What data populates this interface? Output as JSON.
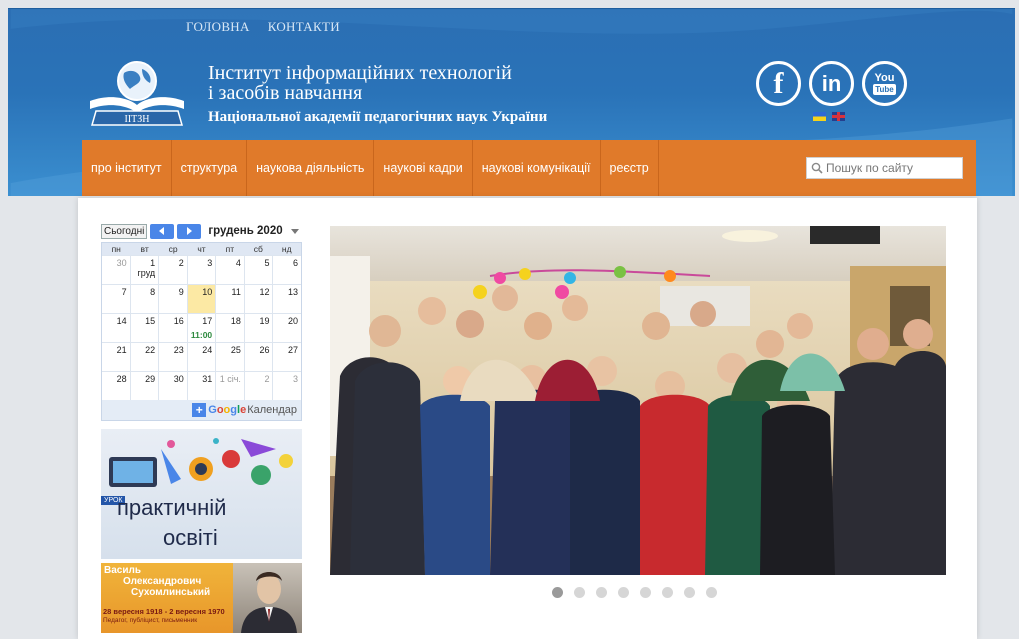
{
  "top_nav": {
    "home": "ГОЛОВНА",
    "contacts": "КОНТАКТИ"
  },
  "logo": {
    "label": "ІІТЗН"
  },
  "titles": {
    "line1": "Інститут інформаційних технологій",
    "line2": "і засобів навчання",
    "line3": "Національної академії педагогічних наук України"
  },
  "social": {
    "facebook": "f",
    "linkedin": "in",
    "youtube_top": "You",
    "youtube_bottom": "Tube"
  },
  "menu": {
    "items": [
      "про інститут",
      "структура",
      "наукова діяльність",
      "наукові кадри",
      "наукові комунікації",
      "реєстр"
    ]
  },
  "search": {
    "placeholder": "Пошук по сайту"
  },
  "calendar": {
    "today": "Сьогодні",
    "month": "грудень 2020",
    "weekdays": [
      "пн",
      "вт",
      "ср",
      "чт",
      "пт",
      "сб",
      "нд"
    ],
    "weeks": [
      [
        "30",
        "1 груд",
        "2",
        "3",
        "4",
        "5",
        "6"
      ],
      [
        "7",
        "8",
        "9",
        "10",
        "11",
        "12",
        "13"
      ],
      [
        "14",
        "15",
        "16",
        "17",
        "18",
        "19",
        "20"
      ],
      [
        "21",
        "22",
        "23",
        "24",
        "25",
        "26",
        "27"
      ],
      [
        "28",
        "29",
        "30",
        "31",
        "1 січ.",
        "2",
        "3"
      ]
    ],
    "event_time": "11:00",
    "google": "Google",
    "calendar_word": "Календар"
  },
  "banner1": {
    "tag": "УРОК",
    "line1": "практичній",
    "line2": "освіті"
  },
  "banner2": {
    "line1": "Василь",
    "line2": "Олександрович",
    "line3": "Сухомлинський",
    "dates": "28 вересня 1918 - 2 вересня 1970",
    "role": "Педагог, публіцист, письменник"
  },
  "slider": {
    "total_dots": 8,
    "active_dot": 1
  },
  "colors": {
    "header_blue": "#2a73b8",
    "menu_orange": "#e07a2a",
    "calendar_highlight": "#fce9a4",
    "google_blue": "#4a86e8"
  }
}
